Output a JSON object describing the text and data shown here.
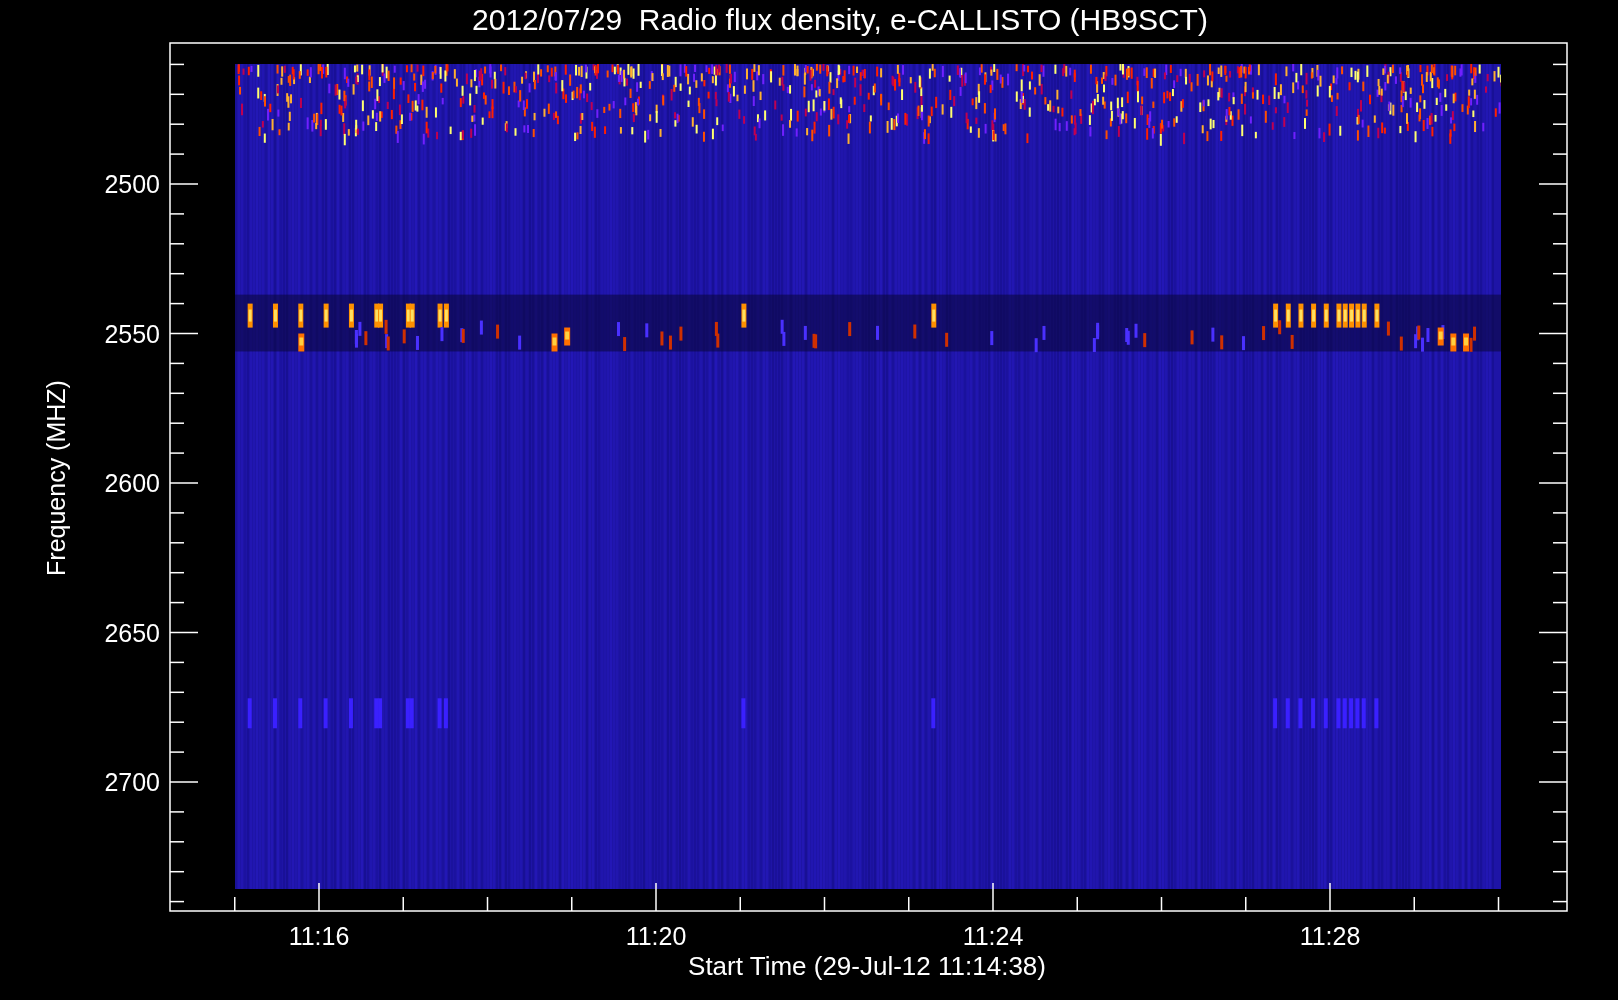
{
  "title": "2012/07/29  Radio flux density, e-CALLISTO (HB9SCT)",
  "y_axis": {
    "label": "Frequency (MHZ)",
    "ticks": [
      "2500",
      "2550",
      "2600",
      "2650",
      "2700"
    ]
  },
  "x_axis": {
    "label": "Start Time (29-Jul-12 11:14:38)",
    "ticks": [
      "11:16",
      "11:20",
      "11:24",
      "11:28"
    ]
  }
}
